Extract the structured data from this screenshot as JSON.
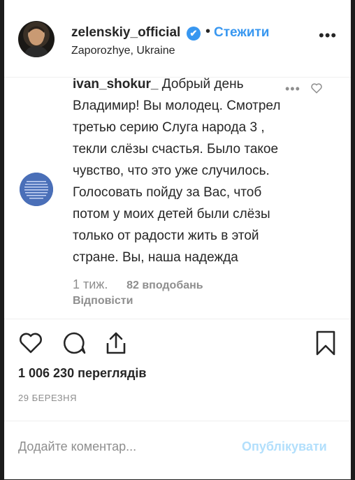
{
  "header": {
    "username": "zelenskiy_official",
    "verified_glyph": "✔",
    "separator": "•",
    "follow_label": "Стежити",
    "location": "Zaporozhye, Ukraine",
    "more_glyph": "•••"
  },
  "comment": {
    "username": "ivan_shokur_",
    "text": "Добрый день Владимир! Вы молодец. Смотрел третью серию Слуга народа 3 , текли слёзы счастья. Было такое чувство, что это уже случилось. Голосовать пойду за Вас, чтоб потом у моих детей были слёзы только от радости жить в этой стране. Вы, наша надежда",
    "time": "1 тиж.",
    "likes": "82 вподобань",
    "reply_label": "Відповісти",
    "more_glyph": "•••"
  },
  "stats": {
    "views": "1 006 230 переглядів",
    "date": "29 БЕРЕЗНЯ"
  },
  "add_comment": {
    "placeholder": "Додайте коментар...",
    "publish_label": "Опублікувати"
  },
  "colors": {
    "accent": "#3897f0",
    "publish_disabled": "#b2dffc",
    "muted": "#8e8e8e",
    "text": "#262626"
  },
  "icons": [
    "verified-icon",
    "more-options-icon",
    "heart-icon",
    "comment-icon",
    "share-icon",
    "bookmark-icon"
  ]
}
